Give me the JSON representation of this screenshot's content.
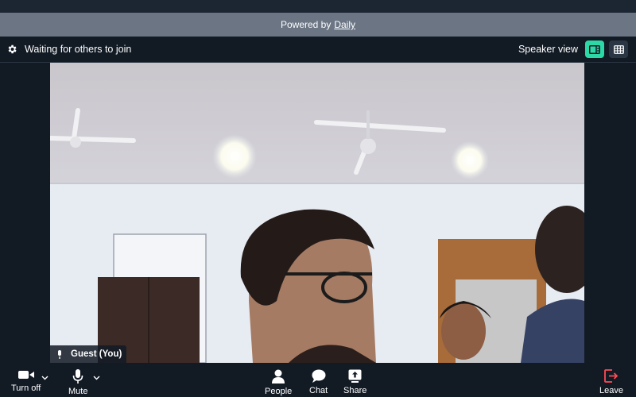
{
  "banner": {
    "powered_prefix": "Powered by",
    "powered_link": "Daily"
  },
  "header": {
    "status_text": "Waiting for others to join",
    "view_label": "Speaker view",
    "settings_icon": "gear-icon",
    "speaker_view_icon": "speaker-layout-icon",
    "grid_view_icon": "grid-layout-icon"
  },
  "video": {
    "participant_label": "Guest (You)",
    "mic_icon": "microphone-icon"
  },
  "toolbar": {
    "camera_label": "Turn off",
    "mic_label": "Mute",
    "people_label": "People",
    "chat_label": "Chat",
    "share_label": "Share",
    "leave_label": "Leave"
  },
  "colors": {
    "accent": "#2bd8a6",
    "leave": "#ff4b55",
    "background": "#121a24",
    "banner": "#6b7584"
  }
}
